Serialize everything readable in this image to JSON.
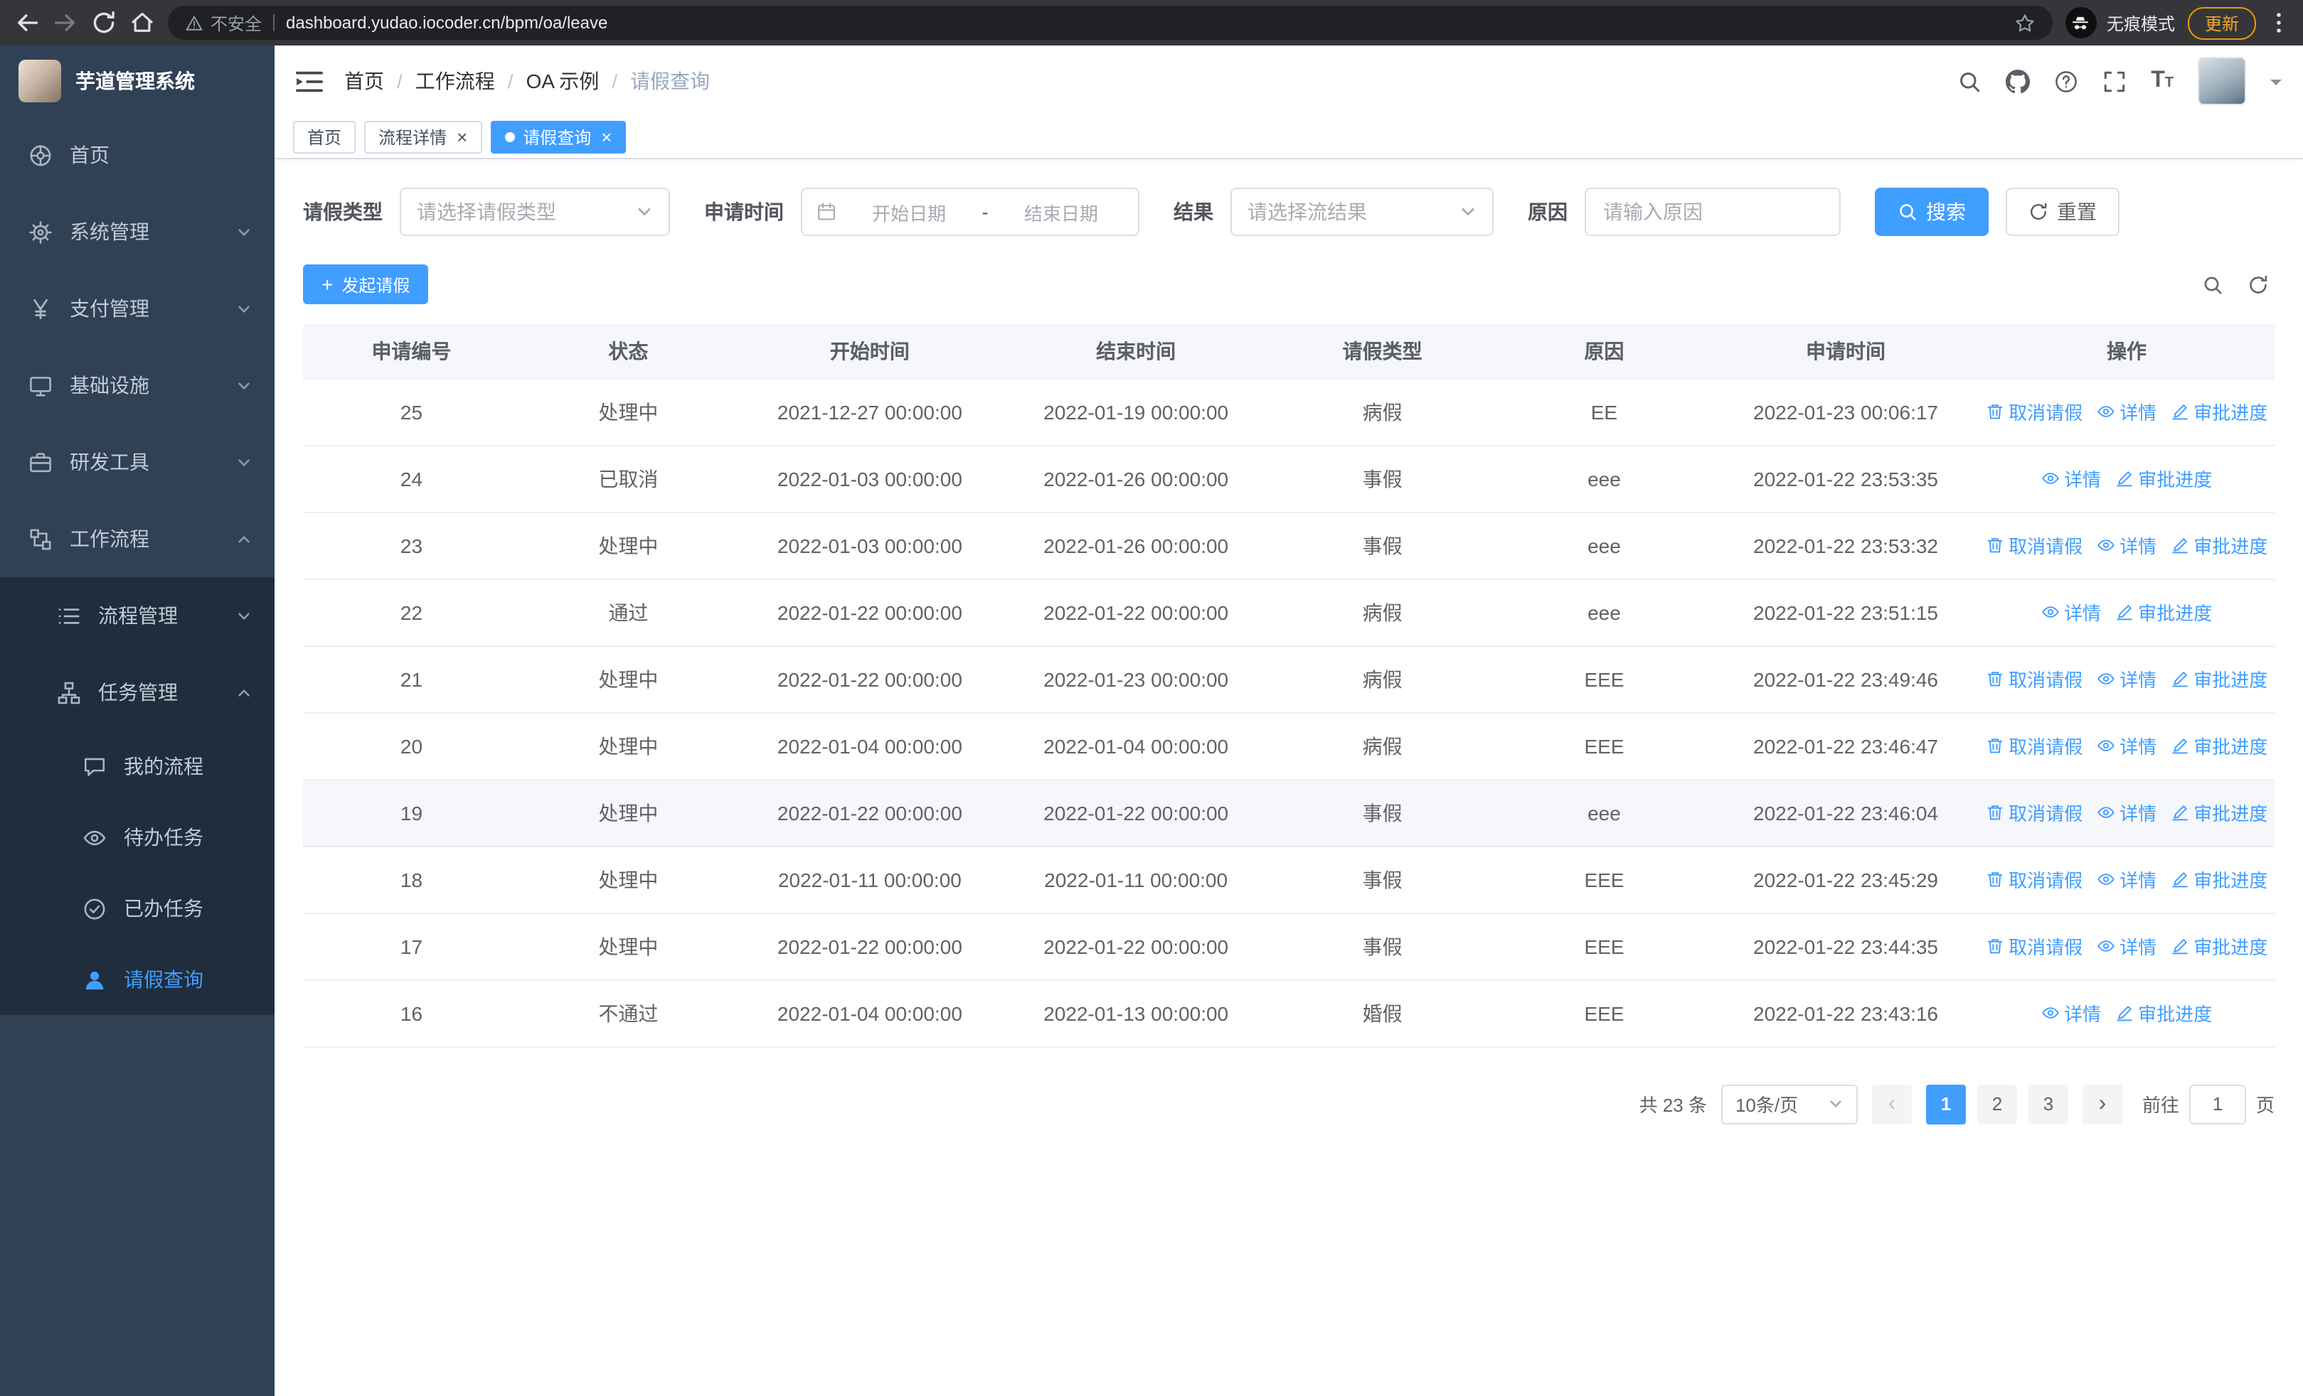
{
  "colors": {
    "accent": "#409eff",
    "sidebar_bg": "#304156",
    "sidebar_submenu_bg": "#1f2d3d",
    "table_header_bg": "#f5f7fa"
  },
  "browser": {
    "security_label": "不安全",
    "url": "dashboard.yudao.iocoder.cn/bpm/oa/leave",
    "incognito_label": "无痕模式",
    "update_label": "更新"
  },
  "app": {
    "title": "芋道管理系统"
  },
  "sidebar": {
    "menu": [
      {
        "label": "首页",
        "icon": "dashboard-icon",
        "level": 1
      },
      {
        "label": "系统管理",
        "icon": "gear-icon",
        "level": 1,
        "chevron": "down"
      },
      {
        "label": "支付管理",
        "icon": "payment-icon",
        "level": 1,
        "chevron": "down"
      },
      {
        "label": "基础设施",
        "icon": "infra-icon",
        "level": 1,
        "chevron": "down"
      },
      {
        "label": "研发工具",
        "icon": "tools-icon",
        "level": 1,
        "chevron": "down"
      },
      {
        "label": "工作流程",
        "icon": "workflow-icon",
        "level": 1,
        "chevron": "up"
      },
      {
        "label": "流程管理",
        "icon": "list-icon",
        "level": 2,
        "chevron": "down"
      },
      {
        "label": "任务管理",
        "icon": "tree-icon",
        "level": 2,
        "chevron": "up"
      },
      {
        "label": "我的流程",
        "icon": "chat-icon",
        "level": 3
      },
      {
        "label": "待办任务",
        "icon": "eye-icon",
        "level": 3
      },
      {
        "label": "已办任务",
        "icon": "check-icon",
        "level": 3
      },
      {
        "label": "请假查询",
        "icon": "user-icon",
        "level": 3,
        "active": true
      }
    ]
  },
  "header": {
    "breadcrumb": [
      "首页",
      "工作流程",
      "OA 示例",
      "请假查询"
    ],
    "separator": "/"
  },
  "tabs": [
    {
      "label": "首页",
      "closable": false,
      "active": false
    },
    {
      "label": "流程详情",
      "closable": true,
      "active": false
    },
    {
      "label": "请假查询",
      "closable": true,
      "active": true
    }
  ],
  "filters": {
    "leave_type_label": "请假类型",
    "leave_type_placeholder": "请选择请假类型",
    "apply_time_label": "申请时间",
    "start_date_placeholder": "开始日期",
    "range_separator": "-",
    "end_date_placeholder": "结束日期",
    "result_label": "结果",
    "result_placeholder": "请选择流结果",
    "reason_label": "原因",
    "reason_placeholder": "请输入原因",
    "search_button": "搜索",
    "reset_button": "重置"
  },
  "toolbar": {
    "create_button": "发起请假"
  },
  "table": {
    "columns": [
      "申请编号",
      "状态",
      "开始时间",
      "结束时间",
      "请假类型",
      "原因",
      "申请时间",
      "操作"
    ],
    "action_labels": {
      "cancel": "取消请假",
      "detail": "详情",
      "progress": "审批进度"
    },
    "rows": [
      {
        "no": "25",
        "status": "处理中",
        "start": "2021-12-27 00:00:00",
        "end": "2022-01-19 00:00:00",
        "type": "病假",
        "reason": "EE",
        "applied": "2022-01-23 00:06:17",
        "cancel": true,
        "highlight": false
      },
      {
        "no": "24",
        "status": "已取消",
        "start": "2022-01-03 00:00:00",
        "end": "2022-01-26 00:00:00",
        "type": "事假",
        "reason": "eee",
        "applied": "2022-01-22 23:53:35",
        "cancel": false,
        "highlight": false
      },
      {
        "no": "23",
        "status": "处理中",
        "start": "2022-01-03 00:00:00",
        "end": "2022-01-26 00:00:00",
        "type": "事假",
        "reason": "eee",
        "applied": "2022-01-22 23:53:32",
        "cancel": true,
        "highlight": false
      },
      {
        "no": "22",
        "status": "通过",
        "start": "2022-01-22 00:00:00",
        "end": "2022-01-22 00:00:00",
        "type": "病假",
        "reason": "eee",
        "applied": "2022-01-22 23:51:15",
        "cancel": false,
        "highlight": false
      },
      {
        "no": "21",
        "status": "处理中",
        "start": "2022-01-22 00:00:00",
        "end": "2022-01-23 00:00:00",
        "type": "病假",
        "reason": "EEE",
        "applied": "2022-01-22 23:49:46",
        "cancel": true,
        "highlight": false
      },
      {
        "no": "20",
        "status": "处理中",
        "start": "2022-01-04 00:00:00",
        "end": "2022-01-04 00:00:00",
        "type": "病假",
        "reason": "EEE",
        "applied": "2022-01-22 23:46:47",
        "cancel": true,
        "highlight": false
      },
      {
        "no": "19",
        "status": "处理中",
        "start": "2022-01-22 00:00:00",
        "end": "2022-01-22 00:00:00",
        "type": "事假",
        "reason": "eee",
        "applied": "2022-01-22 23:46:04",
        "cancel": true,
        "highlight": true
      },
      {
        "no": "18",
        "status": "处理中",
        "start": "2022-01-11 00:00:00",
        "end": "2022-01-11 00:00:00",
        "type": "事假",
        "reason": "EEE",
        "applied": "2022-01-22 23:45:29",
        "cancel": true,
        "highlight": false
      },
      {
        "no": "17",
        "status": "处理中",
        "start": "2022-01-22 00:00:00",
        "end": "2022-01-22 00:00:00",
        "type": "事假",
        "reason": "EEE",
        "applied": "2022-01-22 23:44:35",
        "cancel": true,
        "highlight": false
      },
      {
        "no": "16",
        "status": "不通过",
        "start": "2022-01-04 00:00:00",
        "end": "2022-01-13 00:00:00",
        "type": "婚假",
        "reason": "EEE",
        "applied": "2022-01-22 23:43:16",
        "cancel": false,
        "highlight": false
      }
    ]
  },
  "pagination": {
    "total_text": "共 23 条",
    "page_size": "10条/页",
    "pages": [
      "1",
      "2",
      "3"
    ],
    "active_page": "1",
    "prev_symbol": "‹",
    "next_symbol": "›",
    "goto_label": "前往",
    "goto_value": "1",
    "page_unit": "页"
  }
}
